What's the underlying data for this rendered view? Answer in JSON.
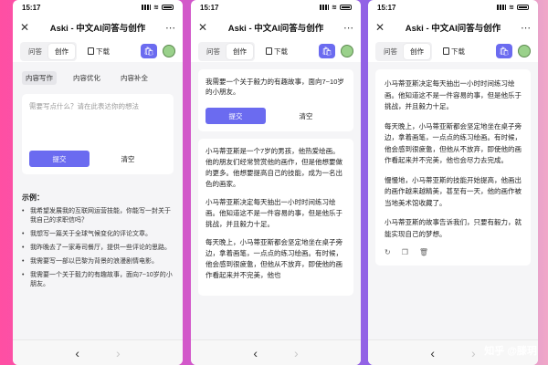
{
  "status": {
    "time": "15:17"
  },
  "header": {
    "title": "Aski - 中文AI问答与创作",
    "close_glyph": "✕",
    "more_glyph": "⋯"
  },
  "toolbar": {
    "tab_qa": "问答",
    "tab_create": "创作",
    "download": "下载",
    "bag_glyph": "🛍"
  },
  "nav": {
    "back": "‹",
    "forward": "›"
  },
  "phone1": {
    "subtabs": [
      "内容写作",
      "内容优化",
      "内容补全"
    ],
    "placeholder": "需要写点什么？请在此表达你的想法",
    "submit": "提交",
    "clear": "清空",
    "examples_title": "示例：",
    "examples": [
      "我希望发展我的互联网运营技能，你能写一封关于我自己的求职信吗？",
      "我想写一篇关于全球气候变化的评论文章。",
      "我昨晚去了一家寿司餐厅，提供一些评论的思路。",
      "我需要写一部以巴黎为背景的浪漫剧情电影。",
      "我需要一个关于毅力的有趣故事，面向7~10岁的小朋友。"
    ]
  },
  "phone2": {
    "question": "我需要一个关于毅力的有趣故事，面向7~10岁的小朋友。",
    "submit": "提交",
    "clear": "清空",
    "paragraphs": [
      "小马蒂亚斯是一个7岁的男孩，他热爱绘画。他的朋友们经常赞赏他的画作，但是他想要做的更多。他想要提高自己的技能，成为一名出色的画家。",
      "小马蒂亚斯决定每天抽出一小时时间练习绘画。他知道这不是一件容易的事，但是他乐于挑战，并且毅力十足。",
      "每天晚上，小马蒂亚斯都会坚定地坐在桌子旁边，拿着画笔，一点点的练习绘画。有时候，他会感到很疲惫，但他从不放弃，即使他的画作看起来并不完美，他也"
    ]
  },
  "phone3": {
    "paragraphs": [
      "小马蒂亚斯决定每天抽出一小时时间练习绘画。他知道这不是一件容易的事，但是他乐于挑战，并且毅力十足。",
      "每天晚上，小马蒂亚斯都会坚定地坐在桌子旁边，拿着画笔，一点点的练习绘画。有时候，他会感到很疲惫，但他从不放弃，即使他的画作看起来并不完美，他也会尽力去完成。",
      "慢慢地，小马蒂亚斯的技能开始提高，他画出的画作越来越精美，甚至有一天，他的画作被当地美术馆收藏了。",
      "小马蒂亚斯的故事告诉我们，只要有毅力，就能实现自己的梦想。"
    ],
    "action_icons": [
      "↻",
      "❐",
      "🗑"
    ]
  },
  "watermark": "知乎 @滕玥"
}
